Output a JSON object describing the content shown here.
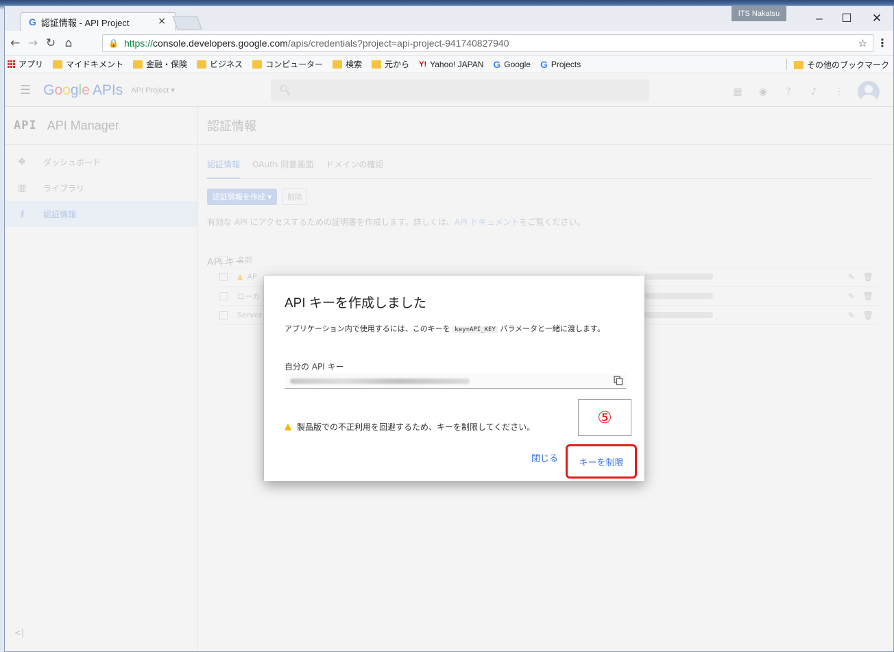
{
  "browser": {
    "tab_title": "認証情報 - API Project",
    "tab_close": "×",
    "user_badge": "ITS Nakatsu",
    "url_scheme": "https://",
    "url_host": "console.developers.google.com",
    "url_path": "/apis/credentials?project=api-project-941740827940",
    "bookmarks": [
      {
        "label": "アプリ",
        "icon": "apps-icon"
      },
      {
        "label": "マイドキメント",
        "icon": "folder-icon"
      },
      {
        "label": "金融・保険",
        "icon": "folder-icon"
      },
      {
        "label": "ビジネス",
        "icon": "folder-icon"
      },
      {
        "label": "コンピューター",
        "icon": "folder-icon"
      },
      {
        "label": "検索",
        "icon": "folder-icon"
      },
      {
        "label": "元から",
        "icon": "folder-icon"
      },
      {
        "label": "Yahoo! JAPAN",
        "icon": "yahoo-icon"
      },
      {
        "label": "Google",
        "icon": "google-icon"
      },
      {
        "label": "Projects",
        "icon": "google-icon"
      }
    ],
    "other_bookmarks": "その他のブックマーク"
  },
  "app": {
    "logo_google": "Google",
    "logo_apis": "APIs",
    "project": "API Project ▾",
    "search_icon": "search-icon"
  },
  "sidebar": {
    "api_badge": "API",
    "title": "API Manager",
    "items": [
      {
        "label": "ダッシュボード",
        "icon": "dashboard-icon"
      },
      {
        "label": "ライブラリ",
        "icon": "library-icon"
      },
      {
        "label": "認証情報",
        "icon": "key-icon"
      }
    ],
    "collapse": "<|"
  },
  "main": {
    "title": "認証情報",
    "tabs": [
      "認証情報",
      "OAuth 同意画面",
      "ドメインの確認"
    ],
    "create_button": "認証情報を作成 ▾",
    "delete_button": "削除",
    "desc_prefix": "有効な API にアクセスするための証明書を作成します。詳しくは、",
    "desc_link": "API ドキュメント",
    "desc_suffix": "をご覧ください。",
    "section_title": "API キー",
    "col_name": "名前",
    "rows": [
      "AP",
      "ローカ",
      "Server"
    ]
  },
  "dialog": {
    "title": "API キーを作成しました",
    "text_before": "アプリケーション内で使用するには、このキーを",
    "code": "key=API_KEY",
    "text_after": "パラメータと一緒に渡します。",
    "key_label": "自分の API キー",
    "warning": "製品版での不正利用を回避するため、キーを制限してください。",
    "step_marker": "⑤",
    "close_button": "閉じる",
    "restrict_button": "キーを制限"
  }
}
